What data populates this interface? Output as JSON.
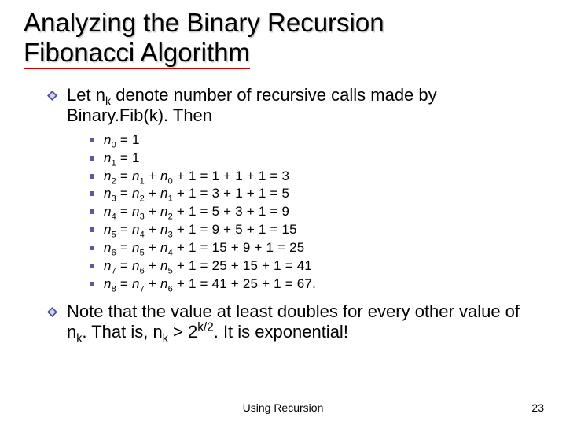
{
  "title": {
    "line1": "Analyzing the Binary Recursion",
    "line2_a": "Fibonacci",
    "line2_b": " Algorithm"
  },
  "bullet_intro_a": "Let n",
  "bullet_intro_b": " denote number of recursive calls made by Binary.Fib(k).  Then",
  "sub_k": "k",
  "eq0_b": " = 1",
  "eq1_b": " = 1",
  "eq2_mid": " + 1 = 1 + 1 + 1 = 3",
  "eq3_mid": " + 1 = 3 + 1 + 1 = 5",
  "eq4_mid": " + 1 = 5 + 3 + 1 = 9",
  "eq5_mid": " + 1 = 9 + 5 + 1 = 15",
  "eq6_mid": " + 1 = 15 + 9 + 1 = 25",
  "eq7_mid": " + 1 = 25 + 15 + 1 = 41",
  "eq8_mid": " + 1 = 41 + 25 + 1 = 67.",
  "eq_eq": " = ",
  "eq_plus": " + ",
  "n": "n",
  "s0": "0",
  "s1": "1",
  "s2": "2",
  "s3": "3",
  "s4": "4",
  "s5": "5",
  "s6": "6",
  "s7": "7",
  "s8": "8",
  "note_a": "Note that the value at least doubles for every other value of n",
  "note_b": ".  That is, n",
  "note_c": " > 2",
  "note_d": ". It is exponential!",
  "note_exp": "k/2",
  "footer_center": "Using Recursion",
  "footer_right": "23"
}
